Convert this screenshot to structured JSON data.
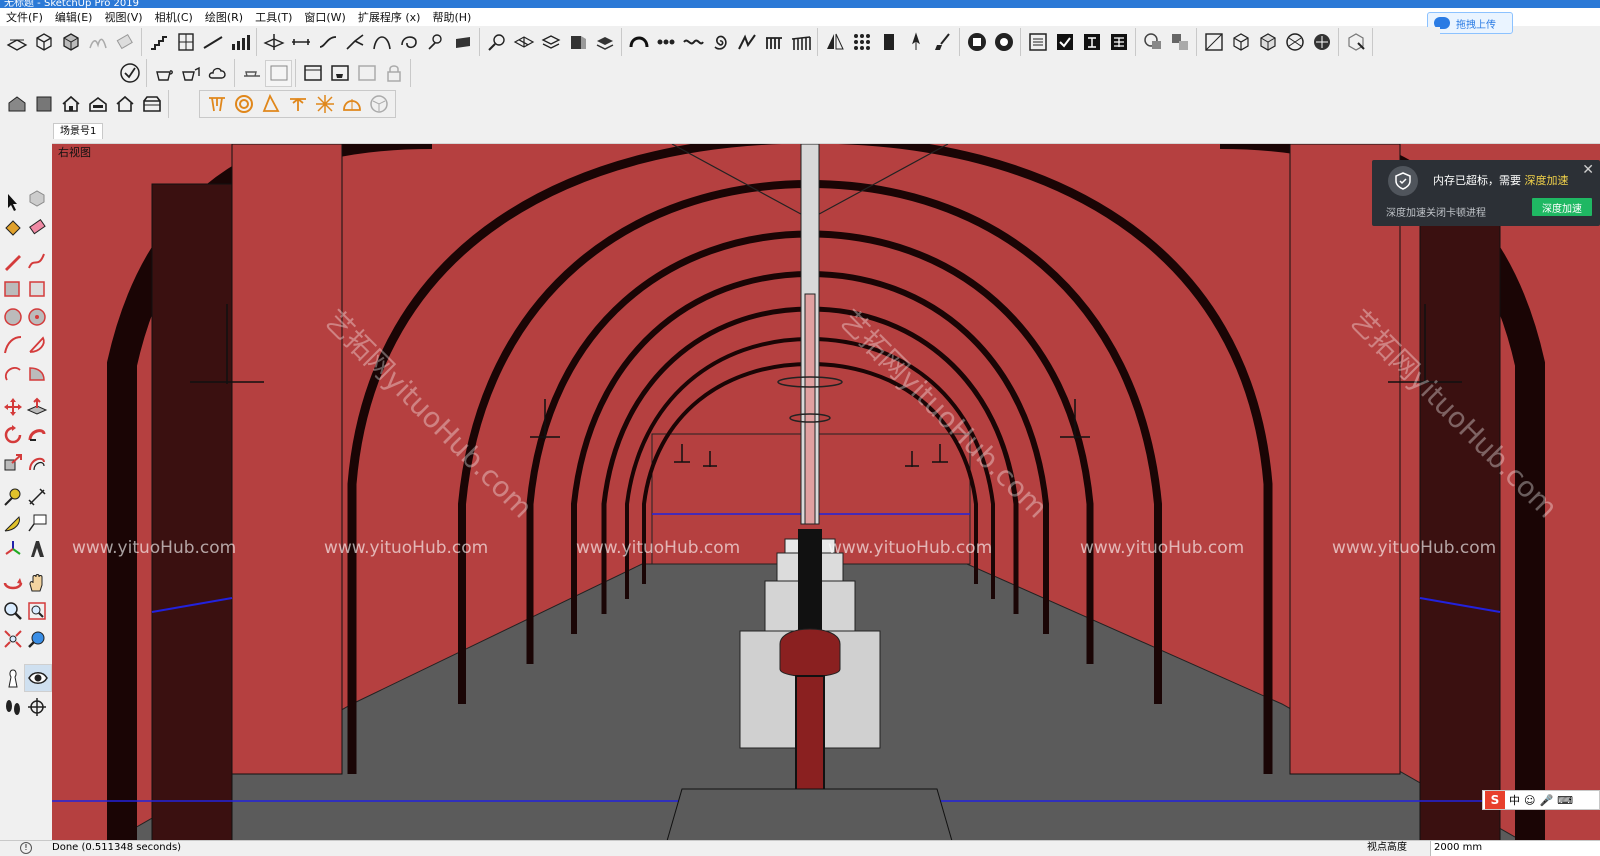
{
  "window": {
    "title": "无标题 - SketchUp Pro 2019"
  },
  "menu": [
    "文件(F)",
    "编辑(E)",
    "视图(V)",
    "相机(C)",
    "绘图(R)",
    "工具(T)",
    "窗口(W)",
    "扩展程序 (x)",
    "帮助(H)"
  ],
  "upload_button": {
    "label": "拖拽上传"
  },
  "scene": {
    "tab_label": "场景号1",
    "view_label": "右视图"
  },
  "watermark": {
    "text": "www.yituoHub.com",
    "diag_text": "艺拓网yituoHub.com"
  },
  "notification": {
    "message": "内存已超标，需要",
    "highlight": "深度加速",
    "sub_text": "深度加速关闭卡顿进程",
    "action_label": "深度加速",
    "close_glyph": "✕"
  },
  "status": {
    "done_text": "Done (0.511348 seconds)",
    "vc_label": "视点高度",
    "vc_value": "2000 mm"
  },
  "ime": {
    "logo": "S",
    "mode": "中"
  },
  "colors": {
    "wall": "#b54040",
    "arch_dark": "#4a1010",
    "floor": "#5b5b5b",
    "blue_line": "#2222dd"
  }
}
